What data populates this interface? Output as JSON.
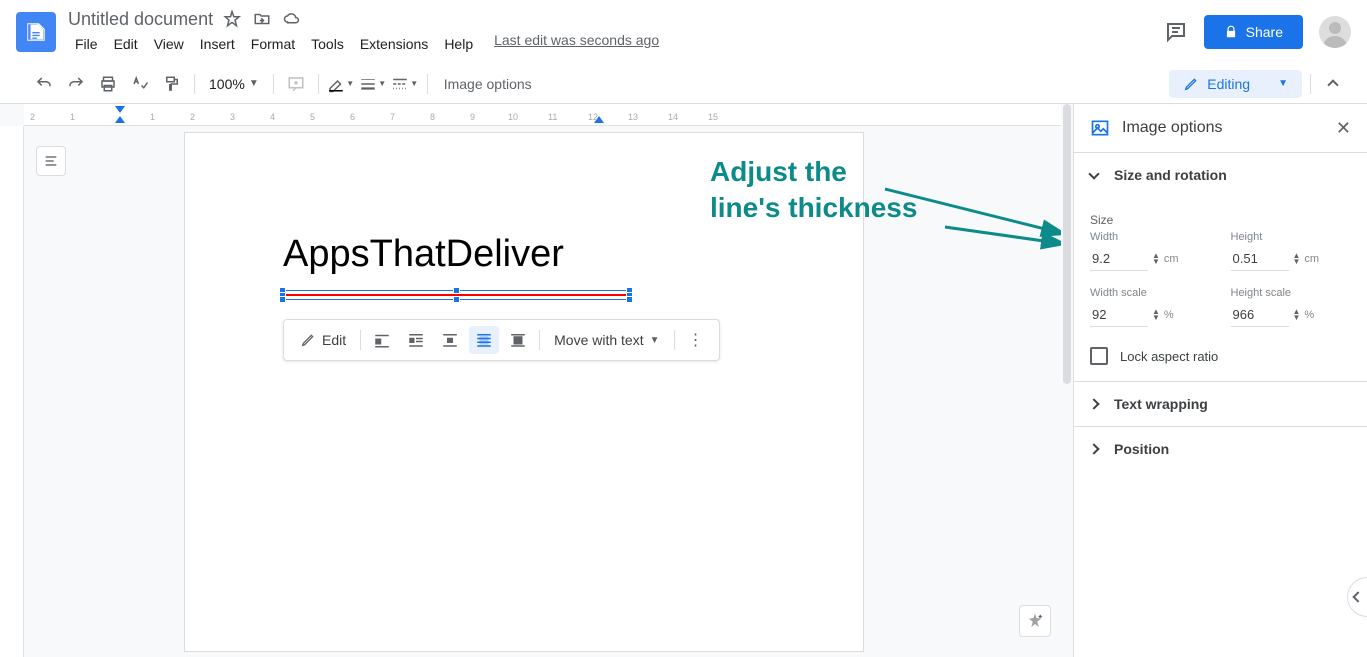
{
  "doc_title": "Untitled document",
  "menubar": [
    "File",
    "Edit",
    "View",
    "Insert",
    "Format",
    "Tools",
    "Extensions",
    "Help"
  ],
  "last_edit": "Last edit was seconds ago",
  "share_label": "Share",
  "toolbar": {
    "zoom": "100%",
    "image_options": "Image options",
    "editing": "Editing"
  },
  "ruler_ticks": [
    "2",
    "1",
    "1",
    "2",
    "3",
    "4",
    "5",
    "6",
    "7",
    "8",
    "9",
    "10",
    "11",
    "12",
    "13",
    "14",
    "15"
  ],
  "document_text": "AppsThatDeliver",
  "context": {
    "edit": "Edit",
    "move_with_text": "Move with text"
  },
  "annotation": {
    "line1": "Adjust the",
    "line2": "line's thickness"
  },
  "sidebar": {
    "title": "Image options",
    "sections": {
      "size_rotation": "Size and rotation",
      "text_wrapping": "Text wrapping",
      "position": "Position"
    },
    "size_label": "Size",
    "width_label": "Width",
    "height_label": "Height",
    "width_value": "9.2",
    "height_value": "0.51",
    "unit_cm": "cm",
    "width_scale_label": "Width scale",
    "height_scale_label": "Height scale",
    "width_scale_value": "92",
    "height_scale_value": "966",
    "unit_pct": "%",
    "lock_aspect": "Lock aspect ratio"
  }
}
